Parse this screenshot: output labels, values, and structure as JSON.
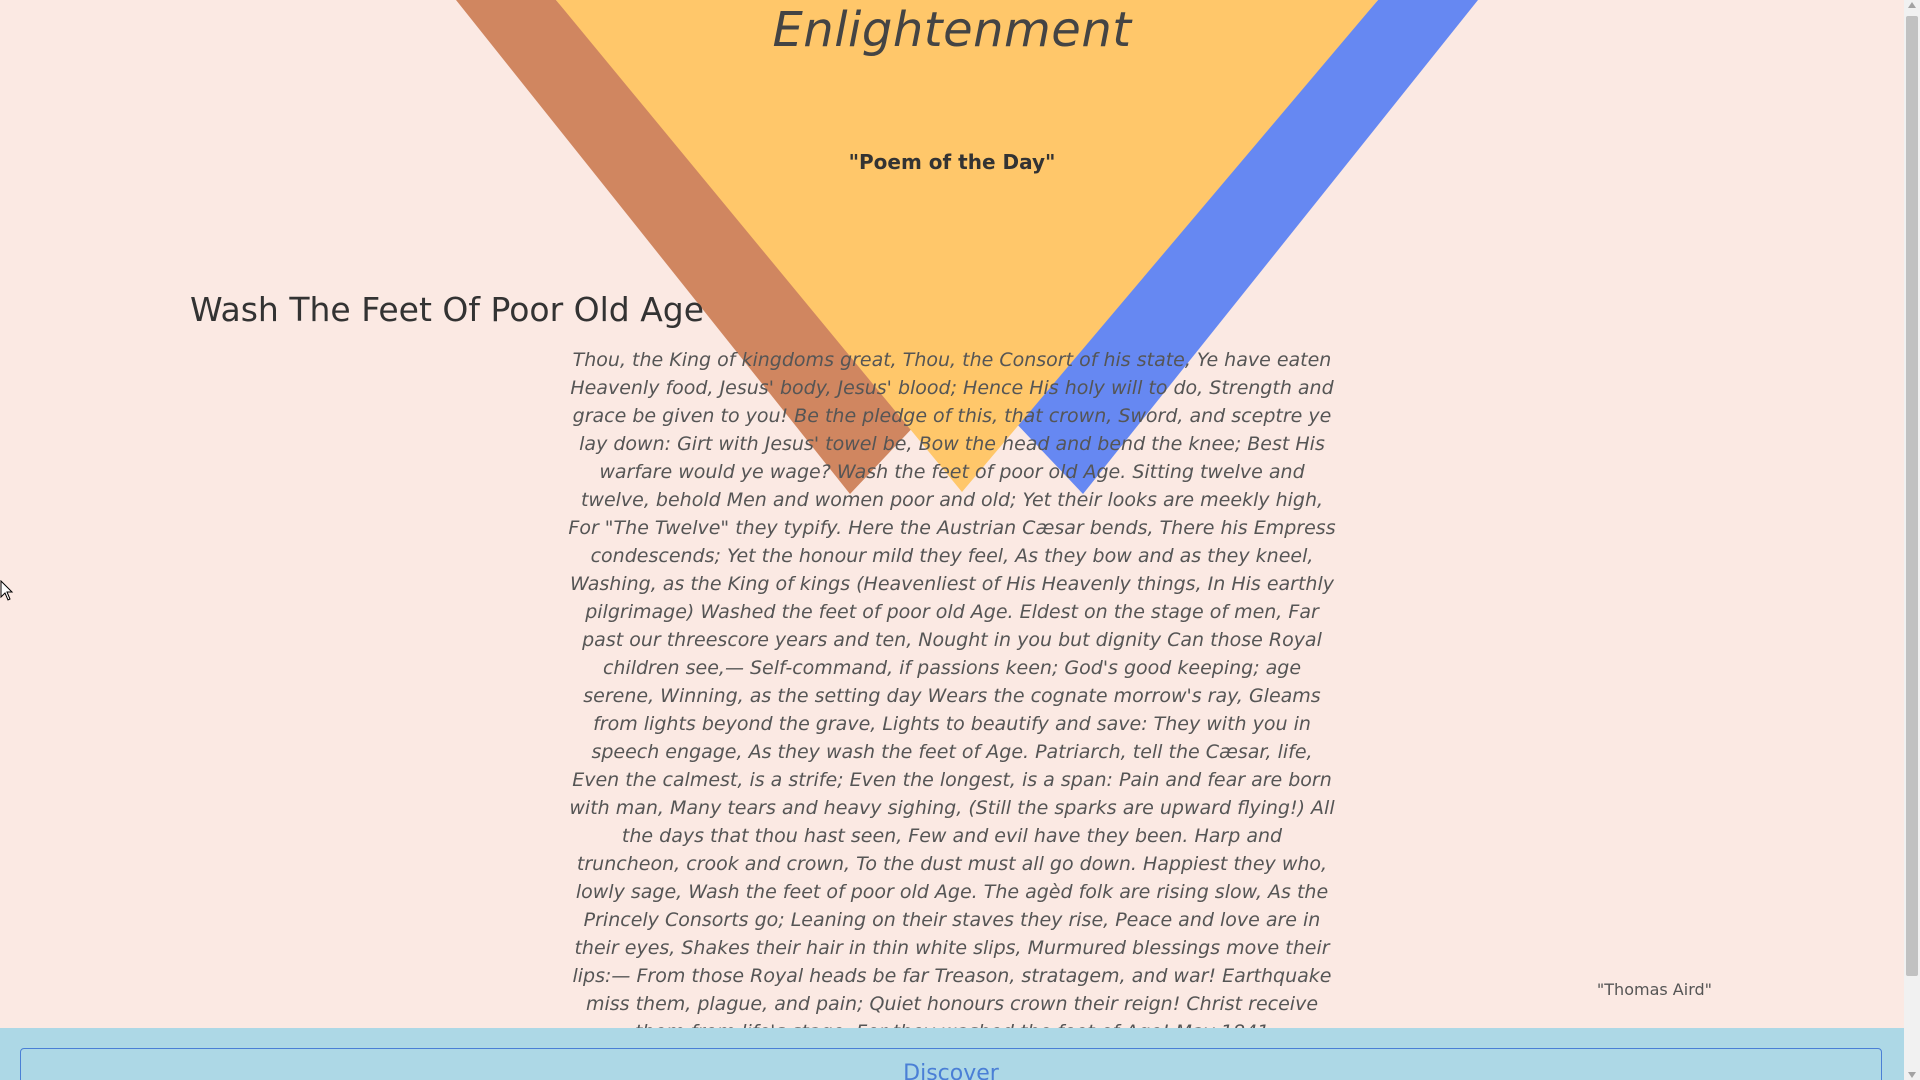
{
  "header": {
    "site_title": "Enlightenment",
    "subtitle": "\"Poem of the Day\""
  },
  "poem": {
    "title": "Wash The Feet Of Poor Old Age",
    "body": "Thou, the King of kingdoms great, Thou, the Consort of his state, Ye have eaten Heavenly food, Jesus' body, Jesus' blood; Hence His holy will to do, Strength and grace be given to you! Be the pledge of this, that crown, Sword, and sceptre ye lay down: Girt with Jesus' towel be, Bow the head and bend the knee; Best His warfare would ye wage? Wash the feet of poor old Age. Sitting twelve and twelve, behold Men and women poor and old; Yet their looks are meekly high, For \"The Twelve\" they typify. Here the Austrian Cæsar bends, There his Empress condescends; Yet the honour mild they feel, As they bow and as they kneel, Washing, as the King of kings (Heavenliest of His Heavenly things, In His earthly pilgrimage) Washed the feet of poor old Age. Eldest on the stage of men, Far past our threescore years and ten, Nought in you but dignity Can those Royal children see,— Self-command, if passions keen; God's good keeping; age serene, Winning, as the setting day Wears the cognate morrow's ray, Gleams from lights beyond the grave, Lights to beautify and save: They with you in speech engage, As they wash the feet of Age. Patriarch, tell the Cæsar, life, Even the calmest, is a strife; Even the longest, is a span: Pain and fear are born with man, Many tears and heavy sighing, (Still the sparks are upward flying!) All the days that thou hast seen, Few and evil have they been. Harp and truncheon, crook and crown, To the dust must all go down. Happiest they who, lowly sage, Wash the feet of poor old Age. The agèd folk are rising slow, As the Princely Consorts go; Leaning on their staves they rise, Peace and love are in their eyes, Shakes their hair in thin white slips, Murmured blessings move their lips:— From those Royal heads be far Treason, stratagem, and war! Earthquake miss them, plague, and pain; Quiet honours crown their reign! Christ receive them from life's stage, For they washed the feet of Age! May 1841",
    "author": "\"Thomas Aird\""
  },
  "footer": {
    "discover_label": "Discover"
  },
  "colors": {
    "background": "#fbe9e3",
    "triangle_orange": "#d08660",
    "triangle_yellow": "#ffc76a",
    "triangle_blue": "#6688f2",
    "footer_bg": "#add8e6",
    "button_accent": "#4a7fd6"
  }
}
